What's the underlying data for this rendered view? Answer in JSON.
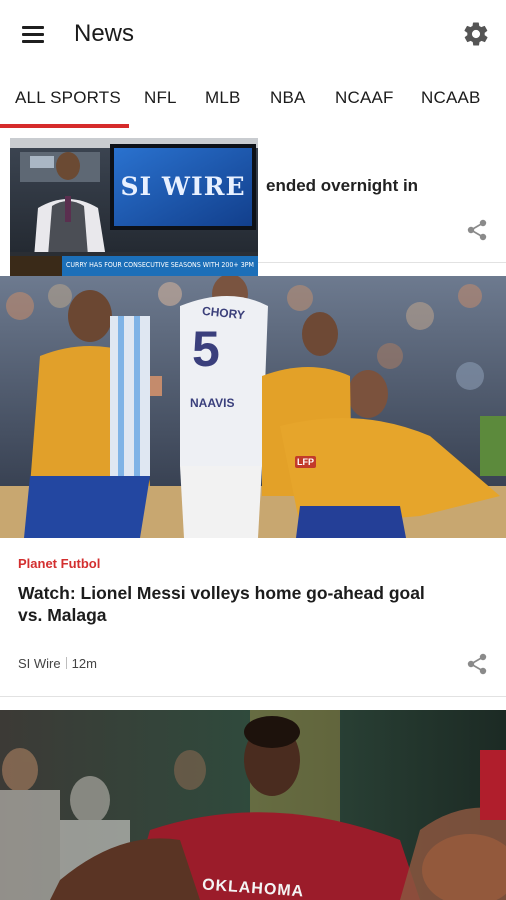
{
  "appbar": {
    "title": "News",
    "menu_icon": "hamburger-menu-icon",
    "settings_icon": "gear-icon"
  },
  "tabs": [
    {
      "label": "ALL SPORTS",
      "selected": true
    },
    {
      "label": "NFL",
      "selected": false
    },
    {
      "label": "MLB",
      "selected": false
    },
    {
      "label": "NBA",
      "selected": false
    },
    {
      "label": "NCAAF",
      "selected": false
    },
    {
      "label": "NCAAB",
      "selected": false
    }
  ],
  "colors": {
    "accent": "#d62b2b",
    "kicker": "#d32f2f",
    "si_wire_blue": "#1f5fb4",
    "ticker_bg": "#1c6fb8"
  },
  "card1": {
    "headline": "ended overnight in",
    "video": {
      "screen_text": "SI WIRE",
      "ticker_text": "CURRY HAS FOUR CONSECUTIVE SEASONS WITH 200+ 3PM"
    },
    "share_icon": "share-icon"
  },
  "card2": {
    "image": {
      "jersey_number": "5",
      "jersey_name": "CHORY",
      "sponsor_text": "NAAVIS",
      "patch_text": "LFP"
    },
    "kicker": "Planet Futbol",
    "headline": "Watch: Lionel Messi volleys home go-ahead goal vs. Malaga",
    "source": "SI Wire",
    "time": "12m",
    "share_icon": "share-icon"
  },
  "card3": {
    "image": {
      "jersey_text": "OKLAHOMA"
    }
  }
}
